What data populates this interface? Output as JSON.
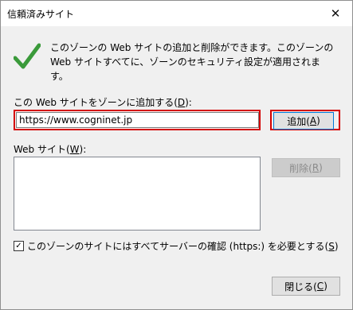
{
  "dialog": {
    "title": "信頼済みサイト",
    "close_glyph": "✕",
    "description": "このゾーンの Web サイトの追加と削除ができます。このゾーンの Web サイトすべてに、ゾーンのセキュリティ設定が適用されます。",
    "add_label_text": "この Web サイトをゾーンに追加する(",
    "add_label_key": "D",
    "add_label_end": "):",
    "url_value": "https://www.cogninet.jp",
    "add_button_text": "追加(",
    "add_button_key": "A",
    "add_button_end": ")",
    "websites_label_text": "Web サイト(",
    "websites_label_key": "W",
    "websites_label_end": "):",
    "remove_button_text": "削除(",
    "remove_button_key": "R",
    "remove_button_end": ")",
    "https_checkbox_text": "このゾーンのサイトにはすべてサーバーの確認 (https:) を必要とする(",
    "https_checkbox_key": "S",
    "https_checkbox_end": ")",
    "https_checked": true,
    "close_button_text": "閉じる(",
    "close_button_key": "C",
    "close_button_end": ")"
  },
  "colors": {
    "check_green": "#3a9a3a",
    "highlight_red": "#d40000"
  },
  "icons": {
    "status": "checkmark-icon"
  }
}
